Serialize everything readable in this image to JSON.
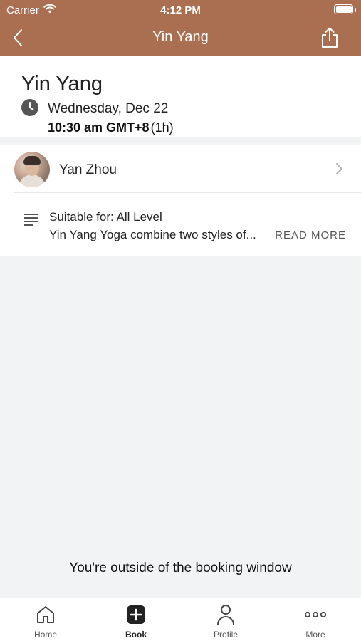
{
  "status_bar": {
    "carrier": "Carrier",
    "time": "4:12 PM"
  },
  "navbar": {
    "title": "Yin Yang",
    "background": "#a96f50"
  },
  "class": {
    "title": "Yin Yang",
    "date": "Wednesday, Dec 22",
    "time": "10:30 am GMT+8",
    "duration": "(1h)"
  },
  "instructor": {
    "name": "Yan Zhou"
  },
  "details": {
    "suitable": "Suitable for: All Level",
    "description": "Yin Yang Yoga combine two styles of...",
    "read_more": "READ MORE"
  },
  "booking_note": "You're outside of the booking window",
  "tabs": [
    {
      "label": "Home",
      "icon": "home-icon"
    },
    {
      "label": "Book",
      "icon": "plus-icon",
      "active": true
    },
    {
      "label": "Profile",
      "icon": "person-icon"
    },
    {
      "label": "More",
      "icon": "more-icon"
    }
  ]
}
